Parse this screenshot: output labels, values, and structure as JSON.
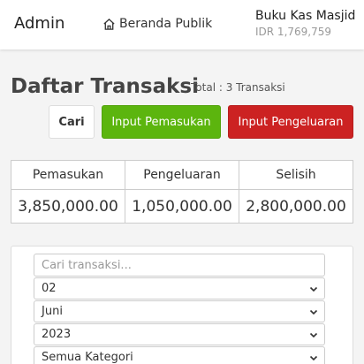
{
  "navbar": {
    "brand": "Admin",
    "public_link": "Beranda Publik",
    "account_name": "Buku Kas Masjid",
    "account_balance": "IDR 1,769,759"
  },
  "page": {
    "title": "Daftar Transaksi",
    "total": "Total : 3 Transaksi"
  },
  "actions": {
    "search_label": "Cari",
    "income_label": "Input Pemasukan",
    "expense_label": "Input Pengeluaran"
  },
  "summary": {
    "headers": [
      "Pemasukan",
      "Pengeluaran",
      "Selisih"
    ],
    "values": [
      "3,850,000.00",
      "1,050,000.00",
      "2,800,000.00"
    ]
  },
  "filter": {
    "search_placeholder": "Cari transaksi...",
    "date_value": "02",
    "month_value": "Juni",
    "year_value": "2023",
    "category_value": "Semua Kategori"
  },
  "colors": {
    "income": "#5cb50e",
    "expense": "#cc2222"
  },
  "icons": {
    "public_link": "home-icon",
    "select": "chevron-down-icon"
  }
}
